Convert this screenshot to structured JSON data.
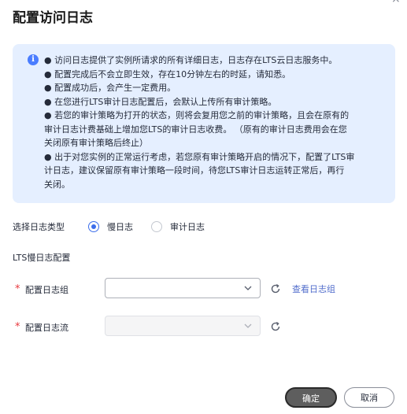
{
  "dialog": {
    "title": "配置访问日志",
    "close_icon": "×"
  },
  "notice": {
    "icon": "info-icon",
    "lines": [
      "● 访问日志提供了实例所请求的所有详细日志，日志存在LTS云日志服务中。",
      "● 配置完成后不会立即生效，存在10分钟左右的时延，请知悉。",
      "● 配置成功后，会产生一定费用。",
      "● 在您进行LTS审计日志配置后，会默认上传所有审计策略。",
      "● 若您的审计策略为打开的状态，则将会复用您之前的审计策略，且会在原有的",
      "审计日志计费基础上增加您LTS的审计日志收费。 （原有的审计日志费用会在您",
      "关闭原有审计策略后终止）",
      "● 出于对您实例的正常运行考虑，若您原有审计策略开启的情况下，配置了LTS审",
      "计日志，建议保留原有审计策略一段时间，待您LTS审计日志运转正常后，再行",
      "关闭。"
    ]
  },
  "log_type": {
    "label": "选择日志类型",
    "options": [
      {
        "label": "慢日志",
        "selected": true
      },
      {
        "label": "审计日志",
        "selected": false
      }
    ]
  },
  "section_title": "LTS慢日志配置",
  "log_group": {
    "required_mark": "*",
    "label": "配置日志组",
    "value": "",
    "view_link": "查看日志组"
  },
  "log_stream": {
    "required_mark": "*",
    "label": "配置日志流",
    "value": "",
    "disabled": true
  },
  "footer": {
    "confirm_label": "确定",
    "cancel_label": "取消"
  },
  "colors": {
    "accent": "#3c6eeb",
    "link": "#526ecc",
    "notice_bg": "#e5efff",
    "required": "#e8383d",
    "primary_button": "#5e5e5e"
  }
}
